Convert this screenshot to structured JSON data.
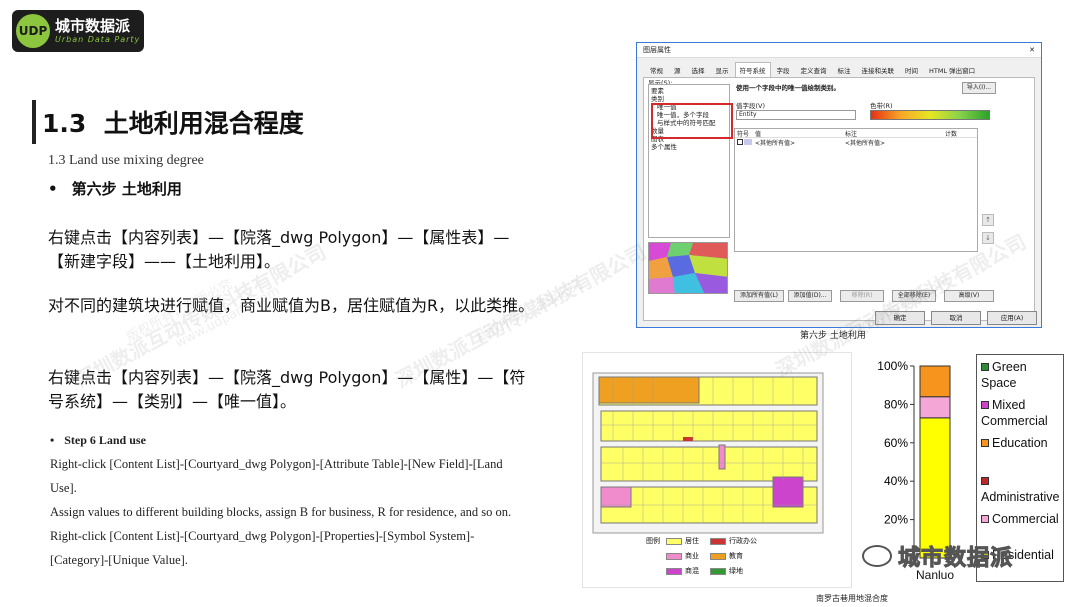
{
  "logo": {
    "cn": "城市数据派",
    "en": "Urban Data Party",
    "mark": "UDP"
  },
  "heading": {
    "number": "1.3",
    "title": "土地利用混合程度",
    "subtitle": "1.3 Land use mixing degree"
  },
  "step_cn": {
    "bullet": "•",
    "text": "第六步 土地利用"
  },
  "paragraphs_cn": [
    "右键点击【内容列表】—【院落_dwg Polygon】—【属性表】—【新建字段】——【土地利用】。",
    "对不同的建筑块进行赋值，商业赋值为B，居住赋值为R，以此类推。",
    "右键点击【内容列表】—【院落_dwg Polygon】—【属性】—【符号系统】—【类别】—【唯一值】。"
  ],
  "step_en": {
    "bullet": "•",
    "text": "Step 6 Land use"
  },
  "paragraphs_en": [
    "Right-click [Content List]-[Courtyard_dwg Polygon]-[Attribute Table]-[New Field]-[Land Use].",
    "Assign values to different building blocks, assign B for business, R for residence, and so on.",
    "Right-click [Content List]-[Courtyard_dwg Polygon]-[Properties]-[Symbol System]-[Category]-[Unique Value]."
  ],
  "dialog": {
    "title": "图层属性",
    "close": "✕",
    "tabs": [
      "常规",
      "源",
      "选择",
      "显示",
      "符号系统",
      "字段",
      "定义查询",
      "标注",
      "连接和关联",
      "时间",
      "HTML 弹出窗口"
    ],
    "active_tab": 4,
    "show_label": "显示(S):",
    "show_items": [
      "要素",
      "类别",
      "唯一值",
      "唯一值，多个字段",
      "与样式中的符号匹配",
      "数量",
      "图表",
      "多个属性"
    ],
    "selected_item": 2,
    "heading": "使用一个字段中的唯一值绘制类别。",
    "import_btn": "导入(I)...",
    "value_field_label": "值字段(V)",
    "value_field": "Entity",
    "color_ramp_label": "色带(R)",
    "grid_headers": [
      "符号",
      "值",
      "标注",
      "计数"
    ],
    "grid_row": {
      "value": "<其他所有值>",
      "label": "<其他所有值>"
    },
    "buttons": [
      "添加所有值(L)",
      "添加值(D)...",
      "移除(R)",
      "全部移除(E)",
      "高级(V)"
    ],
    "side_buttons": [
      "↑",
      "↓"
    ],
    "ok": "确定",
    "cancel": "取消",
    "apply": "应用(A)"
  },
  "dialog_caption": "第六步 土地利用",
  "map": {
    "legend_title": "图例",
    "legend": [
      {
        "label": "居住",
        "color": "#ffff66"
      },
      {
        "label": "行政办公",
        "color": "#cc3333"
      },
      {
        "label": "商业",
        "color": "#f08ccc"
      },
      {
        "label": "教育",
        "color": "#f0a020"
      },
      {
        "label": "商混",
        "color": "#cc44cc"
      },
      {
        "label": "绿地",
        "color": "#339933"
      }
    ],
    "caption": "南罗古巷用地混合度"
  },
  "chart_data": {
    "type": "bar",
    "stacked": true,
    "categories": [
      "Nanluo"
    ],
    "ylim": [
      0,
      100
    ],
    "yticks": [
      "20%",
      "40%",
      "60%",
      "80%",
      "100%"
    ],
    "series": [
      {
        "name": "Residential",
        "values": [
          73
        ],
        "color": "#ffff00"
      },
      {
        "name": "Commercial",
        "values": [
          0
        ],
        "color": "#f4a6d7"
      },
      {
        "name": "Administrative",
        "values": [
          0
        ],
        "color": "#c0272d"
      },
      {
        "name": "Education",
        "values": [
          0
        ],
        "color": "#f7941d"
      },
      {
        "name": "Mixed Commercial",
        "values": [
          11
        ],
        "color": "#f4a6d7"
      },
      {
        "name": "Green Space",
        "values": [
          0
        ],
        "color": "#2e8b3a"
      }
    ],
    "top_segment": {
      "name": "Education",
      "values": [
        16
      ],
      "color": "#f7941d"
    }
  },
  "chart_legend": [
    {
      "label": "Green Space",
      "color": "#2e8b3a"
    },
    {
      "label": "Mixed Commercial",
      "color": "#cc44cc"
    },
    {
      "label": "Education",
      "color": "#f7941d"
    },
    {
      "label": "Administrative",
      "color": "#c0272d"
    },
    {
      "label": "Commercial",
      "color": "#f4a6d7"
    },
    {
      "label": "Residential",
      "color": "#ffff00"
    }
  ],
  "watermarks": [
    "深圳数派互动传媒科技有限公司",
    "版权所有，盗版必究",
    "www.udparty.com"
  ],
  "footer_text": "城市数据派"
}
